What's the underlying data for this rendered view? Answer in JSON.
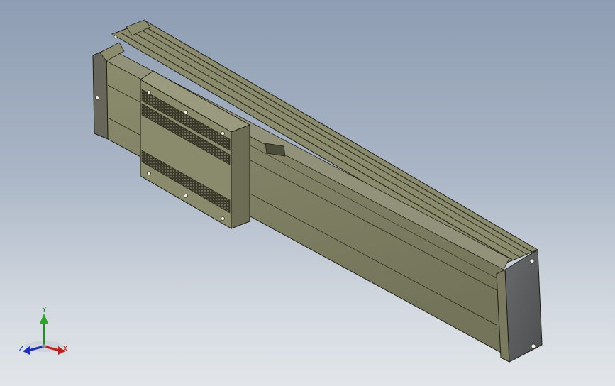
{
  "viewport": {
    "background_top": "#8e9db3",
    "background_bottom": "#e2e6ea"
  },
  "model": {
    "body_color": "#7c7c60",
    "body_light": "#8d8d6f",
    "body_dark": "#5d5d48",
    "endcap_color": "#5a5c5e",
    "edge_color": "#1f1f16"
  },
  "triad": {
    "y_label": "Y",
    "x_label": "X",
    "z_label": "Z",
    "y_color": "#1f8f1f",
    "x_color": "#c0201d",
    "z_color": "#1d2fb8"
  }
}
